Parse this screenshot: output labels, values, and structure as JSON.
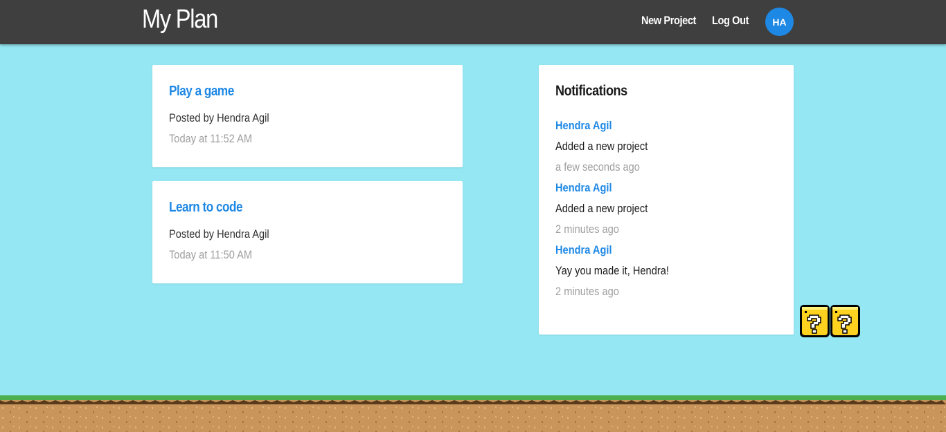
{
  "header": {
    "brand": "My Plan",
    "new_project_label": "New Project",
    "logout_label": "Log Out",
    "avatar_initials": "HA"
  },
  "projects": [
    {
      "title": "Play a game",
      "author": "Posted by Hendra Agil",
      "time": "Today at 11:52 AM"
    },
    {
      "title": "Learn to code",
      "author": "Posted by Hendra Agil",
      "time": "Today at 11:50 AM"
    }
  ],
  "notifications": {
    "heading": "Notifications",
    "items": [
      {
        "user": "Hendra Agil",
        "message": "Added a new project",
        "time": "a few seconds ago"
      },
      {
        "user": "Hendra Agil",
        "message": "Added a new project",
        "time": "2 minutes ago"
      },
      {
        "user": "Hendra Agil",
        "message": "Yay you made it, Hendra!",
        "time": "2 minutes ago"
      }
    ]
  },
  "colors": {
    "background": "#94e7f3",
    "navbar": "#3f3f3f",
    "accent": "#1e88e5",
    "grass": "#4caf50",
    "dirt": "#c9955a"
  },
  "icons": {
    "question_blocks": "question-block-icon",
    "ground": "grass-ground-decoration"
  }
}
